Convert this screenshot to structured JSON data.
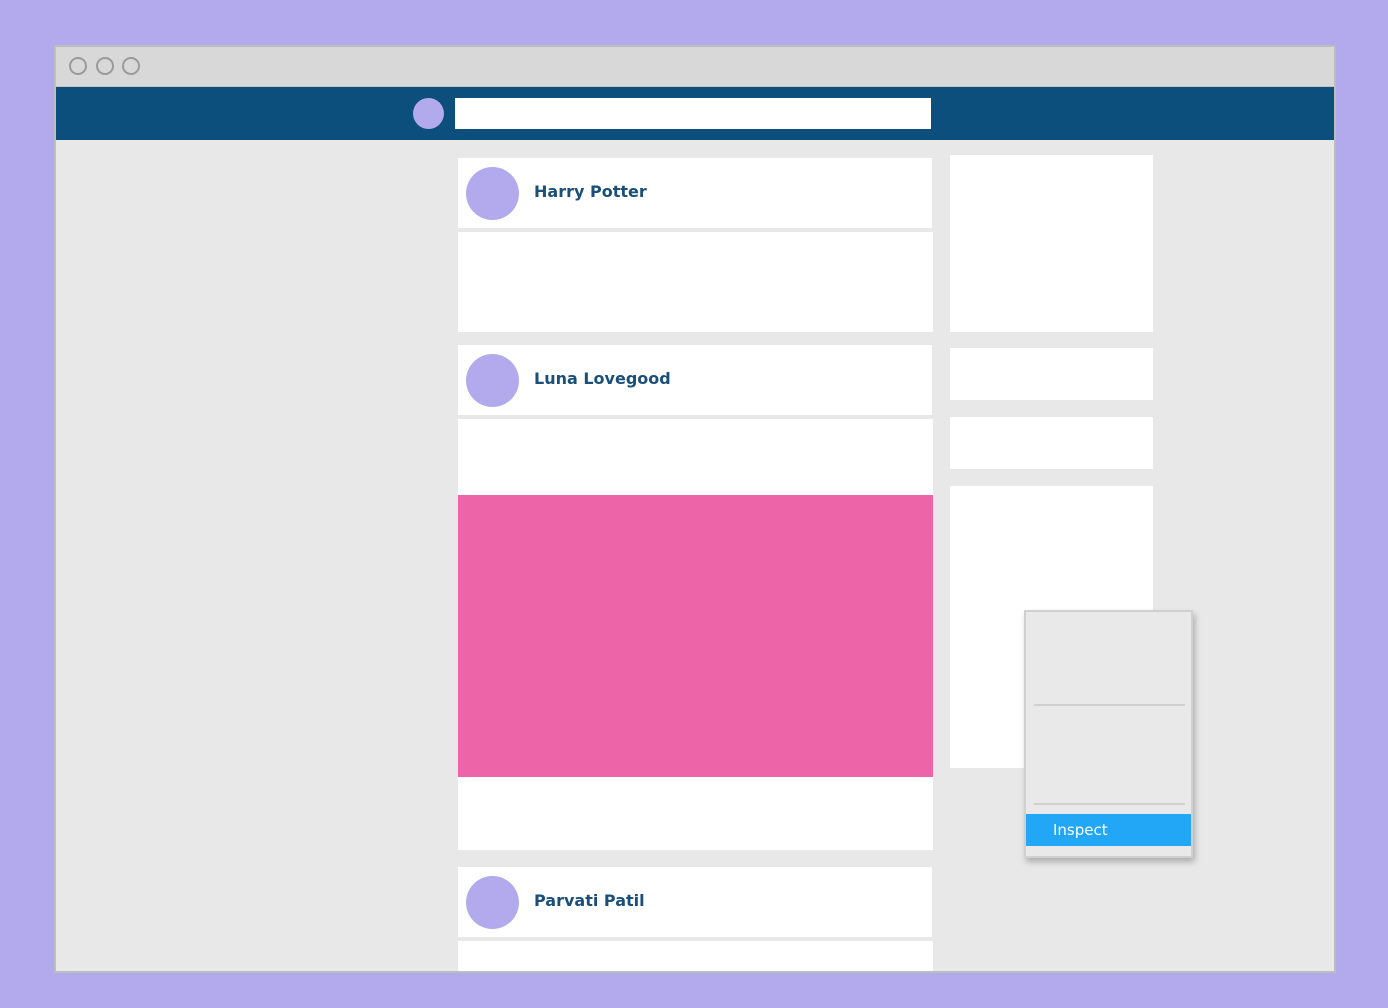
{
  "colors": {
    "background": "#b3aaed",
    "navbar": "#0c4e7c",
    "avatar": "#b3aaed",
    "name_text": "#1a4f7a",
    "image": "#ee64a8",
    "menu_highlight": "#21a7f5"
  },
  "window": {
    "controls": [
      "window-control-icon",
      "window-control-icon",
      "window-control-icon"
    ]
  },
  "search": {
    "value": "",
    "placeholder": ""
  },
  "posts": [
    {
      "author": "Harry Potter"
    },
    {
      "author": "Luna Lovegood"
    },
    {
      "author": "Parvati Patil"
    }
  ],
  "context_menu": {
    "items": [
      {
        "label": ""
      },
      {
        "label": ""
      },
      {
        "label": "Inspect",
        "highlighted": true
      }
    ]
  }
}
